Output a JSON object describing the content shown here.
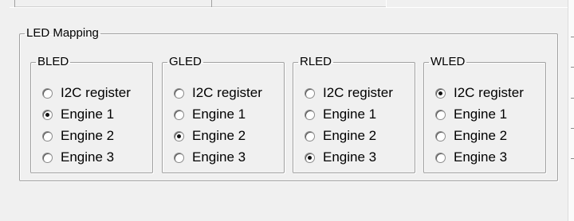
{
  "panel": {
    "title": "LED Mapping",
    "groups": [
      {
        "id": "b",
        "label": "BLED",
        "options": [
          "I2C register",
          "Engine 1",
          "Engine 2",
          "Engine 3"
        ],
        "selected": 1
      },
      {
        "id": "g",
        "label": "GLED",
        "options": [
          "I2C register",
          "Engine 1",
          "Engine 2",
          "Engine 3"
        ],
        "selected": 2
      },
      {
        "id": "r",
        "label": "RLED",
        "options": [
          "I2C register",
          "Engine 1",
          "Engine 2",
          "Engine 3"
        ],
        "selected": 3
      },
      {
        "id": "w",
        "label": "WLED",
        "options": [
          "I2C register",
          "Engine 1",
          "Engine 2",
          "Engine 3"
        ],
        "selected": 0
      }
    ]
  }
}
